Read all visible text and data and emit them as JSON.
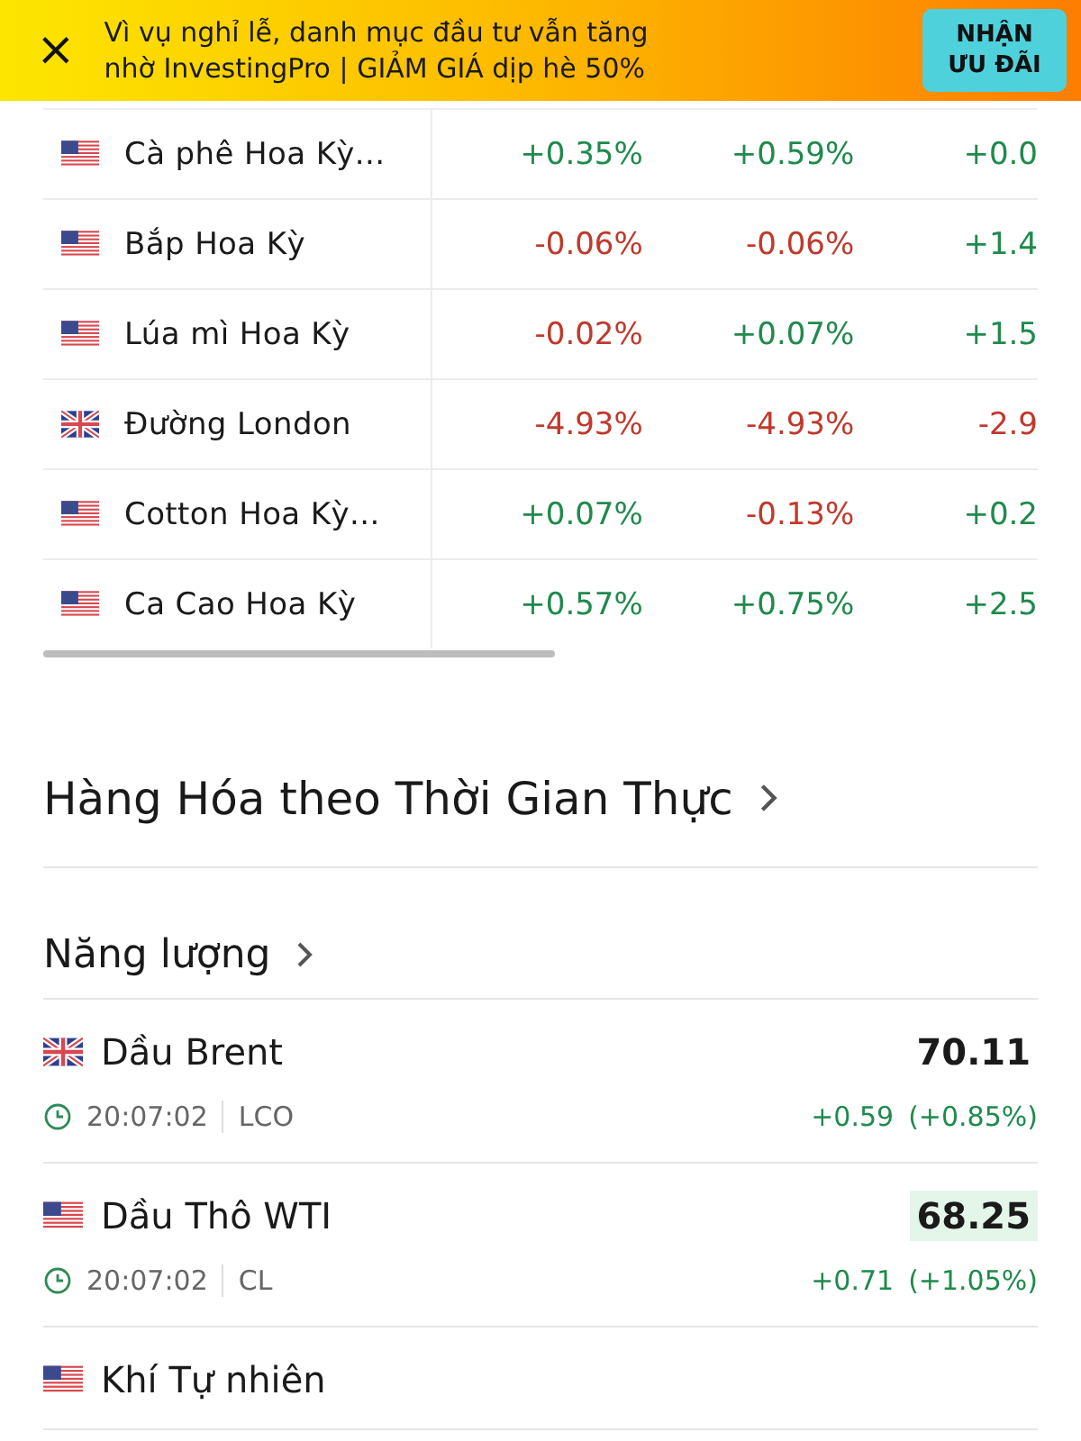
{
  "banner": {
    "close": "×",
    "lines": [
      "Vì vụ nghỉ lễ, danh mục đầu tư vẫn tăng",
      "nhờ InvestingPro | GIẢM GIÁ dịp hè 50%"
    ],
    "button": "NHẬN\nƯU ĐÃI"
  },
  "table": {
    "rows": [
      {
        "kind": "us",
        "name": "Cà phê Hoa Kỳ...",
        "col_2": "+0.35%",
        "col_3": "+0.59%",
        "col_4": "+0.0"
      },
      {
        "kind": "us",
        "name": "Bắp Hoa Kỳ",
        "col_2": "-0.06%",
        "col_3": "-0.06%",
        "col_4": "+1.4"
      },
      {
        "kind": "us",
        "name": "Lúa mì Hoa Kỳ",
        "col_2": "-0.02%",
        "col_3": "+0.07%",
        "col_4": "+1.5"
      },
      {
        "kind": "uk",
        "name": "Đường London",
        "col_2": "-4.93%",
        "col_3": "-4.93%",
        "col_4": "-2.9"
      },
      {
        "kind": "us",
        "name": "Cotton Hoa Kỳ...",
        "col_2": "+0.07%",
        "col_3": "-0.13%",
        "col_4": "+0.2"
      },
      {
        "kind": "us",
        "name": "Ca Cao Hoa Kỳ",
        "col_2": "+0.57%",
        "col_3": "+0.75%",
        "col_4": "+2.5"
      }
    ]
  },
  "section_title": "Hàng Hóa theo Thời Gian Thực",
  "subsection_title": "Năng lượng",
  "quotes": [
    {
      "kind": "uk",
      "name": "Dầu Brent",
      "price": "70.11",
      "highlighted": false,
      "time": "20:07:02",
      "symbol": "LCO",
      "change": "+0.59",
      "change_pct": "(+0.85%)"
    },
    {
      "kind": "us",
      "name": "Dầu Thô WTI",
      "price": "68.25",
      "highlighted": true,
      "time": "20:07:02",
      "symbol": "CL",
      "change": "+0.71",
      "change_pct": "(+1.05%)"
    },
    {
      "kind": "us",
      "name": "Khí Tự nhiên"
    }
  ]
}
